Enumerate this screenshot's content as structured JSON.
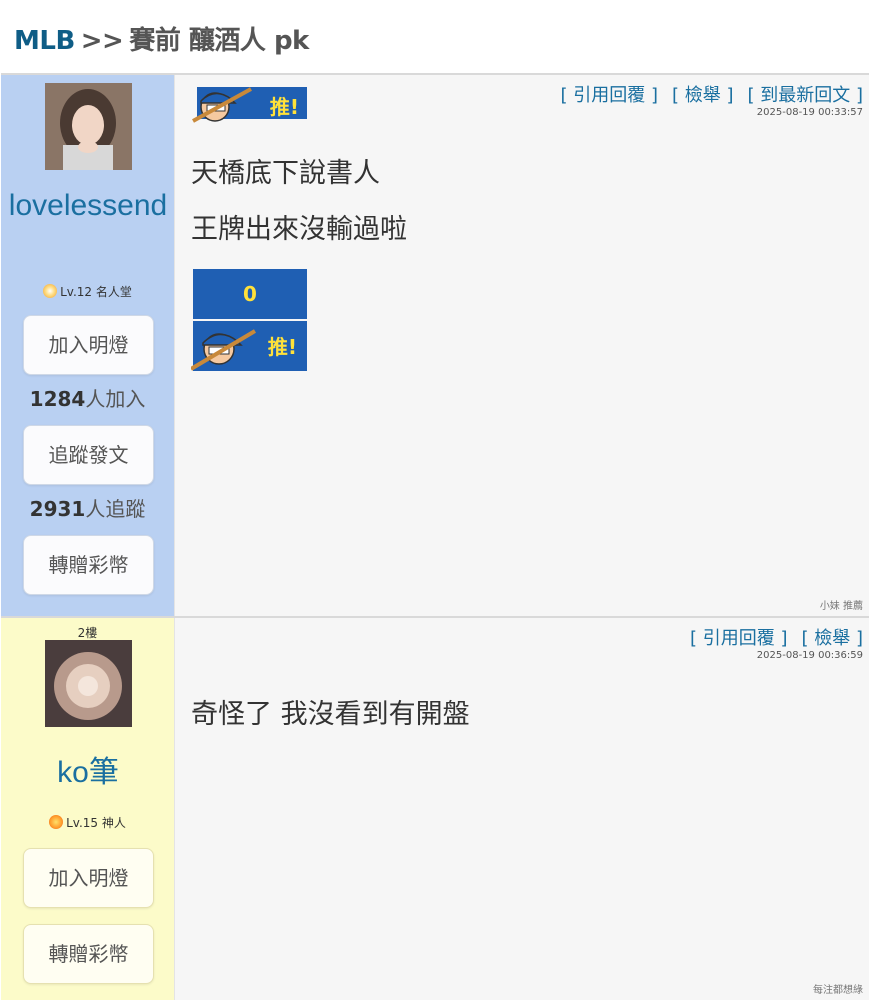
{
  "breadcrumb": {
    "board": "MLB",
    "sep": ">>",
    "title": "賽前 釀酒人 pk"
  },
  "actions_labels": {
    "quote": "[ 引用回覆 ]",
    "report": "[ 檢舉 ]",
    "latest": "[ 到最新回文 ]"
  },
  "posts": [
    {
      "floor": "",
      "username": "lovelessend",
      "level": "Lv.12 名人堂",
      "buttons": {
        "follow_light": "加入明燈",
        "track": "追蹤發文",
        "gift": "轉贈彩幣"
      },
      "light_count": "1284",
      "light_suffix": "人加入",
      "track_count": "2931",
      "track_suffix": "人追蹤",
      "timestamp": "2025-08-19 00:33:57",
      "lines": [
        "天橋底下說書人",
        "王牌出來沒輸過啦"
      ],
      "push_label": "推!",
      "push_count": "0",
      "footnote": "小妹 推薦"
    },
    {
      "floor": "2樓",
      "username": "ko筆",
      "level": "Lv.15 神人",
      "buttons": {
        "follow_light": "加入明燈",
        "gift": "轉贈彩幣"
      },
      "timestamp": "2025-08-19 00:36:59",
      "lines": [
        "奇怪了 我沒看到有開盤"
      ],
      "footnote": "每注都想綠"
    }
  ],
  "colors": {
    "link": "#1a6fa0",
    "board": "#0f5d86",
    "sidebar_blue": "#b9d0f2",
    "sidebar_yellow": "#fcfbc9",
    "push_blue": "#1f5fb3",
    "push_yellow": "#ffe13a"
  }
}
